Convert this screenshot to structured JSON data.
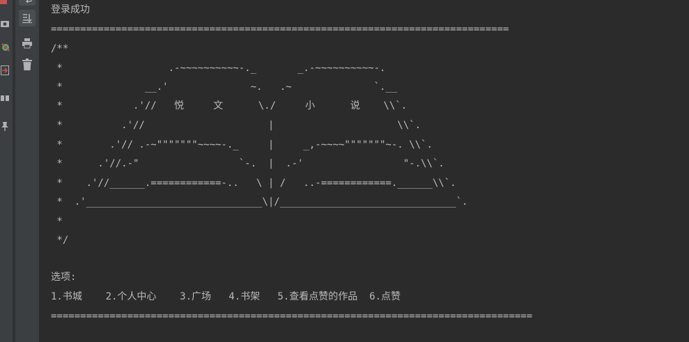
{
  "toolbar": {
    "left_icons": [
      "stop-icon",
      "camera-icon",
      "settings-icon",
      "exit-icon",
      "layout-icon",
      "pin-icon"
    ],
    "right_icons": [
      "soft-wrap-icon",
      "scroll-to-end-icon",
      "print-icon",
      "trash-icon"
    ],
    "accent_red": "#c75450",
    "icon_color": "#afb1b3"
  },
  "console": {
    "login_message": "登录成功",
    "separator_top": "==============================================================================",
    "ascii_art": [
      "/**",
      " *                  .-~~~~~~~~~~-._       _.-~~~~~~~~~~-.",
      " *              __.'              ~.   .~              `.__",
      " *            .'//   悦     文      \\./     小      说    \\\\`.",
      " *          .'//                     |                     \\\\`.",
      " *        .'// .-~\"\"\"\"\"\"\"~~~~-._     |     _,-~~~~\"\"\"\"\"\"\"~-. \\\\`.",
      " *      .'//.-\"                 `-.  |  .-'                 \"-.\\\\`.",
      " *    .'//______.============-..   \\ | /   ..-============.______\\\\`.",
      " *  .'______________________________\\|/______________________________`.",
      " *",
      " */"
    ],
    "options_label": "选项:",
    "options_line": "1.书城    2.个人中心    3.广场   4.书架   5.查看点赞的作品  6.点赞",
    "separator_bottom": "==================================================================================",
    "text_color": "#bbbbbb",
    "background_color": "#2b2b2b"
  }
}
